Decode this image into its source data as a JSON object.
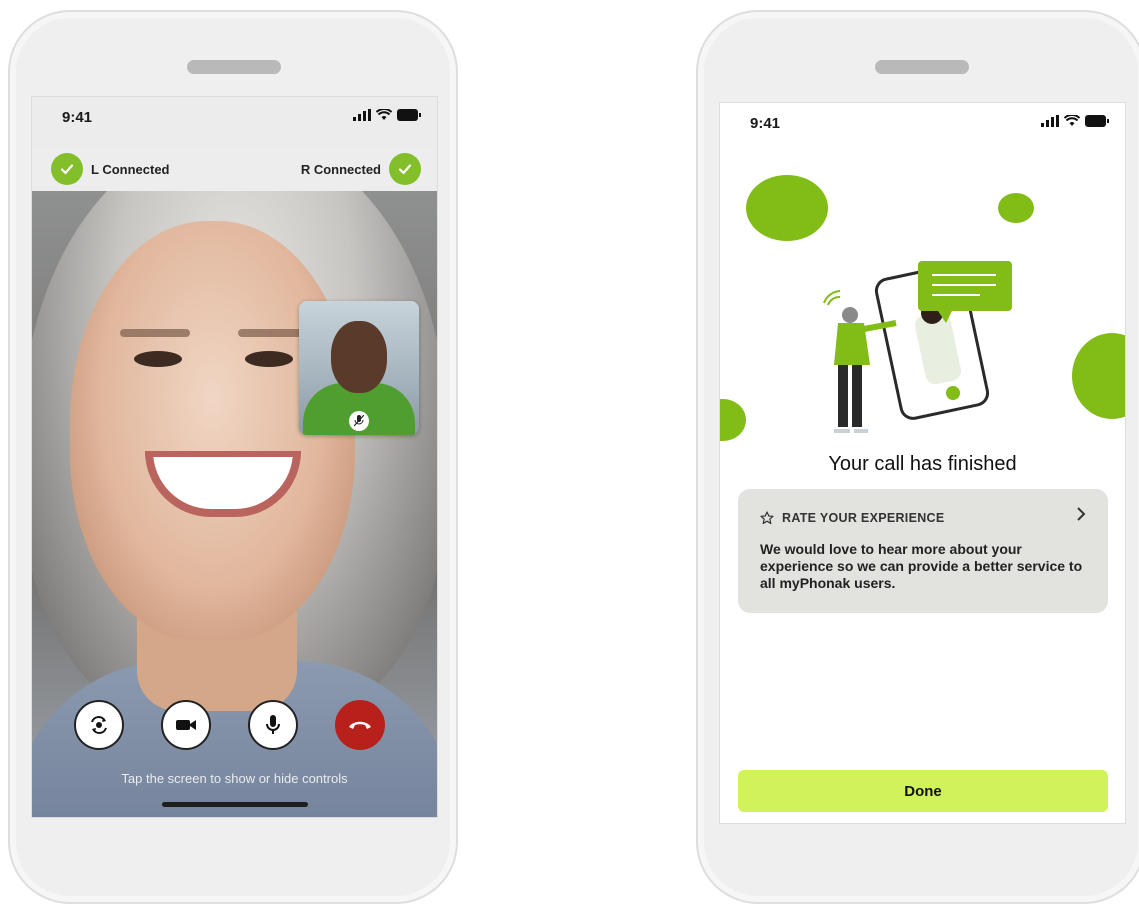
{
  "left_phone": {
    "status_time": "9:41",
    "left_device": {
      "label": "L Connected"
    },
    "right_device": {
      "label": "R Connected"
    },
    "controls": [
      {
        "name": "flip-camera",
        "icon": "camera-rotate-icon"
      },
      {
        "name": "video",
        "icon": "video-camera-icon"
      },
      {
        "name": "microphone",
        "icon": "microphone-icon"
      },
      {
        "name": "end-call",
        "icon": "phone-hangup-icon"
      }
    ],
    "hint": "Tap the screen to show or hide controls"
  },
  "right_phone": {
    "status_time": "9:41",
    "title": "Your call has finished",
    "rate_card": {
      "heading": "RATE YOUR EXPERIENCE",
      "body": "We would love to hear more about your experience so we can provide a better service to all myPhonak users."
    },
    "done_label": "Done"
  },
  "colors": {
    "accent_green": "#82bc16",
    "button_lime": "#d0f25a",
    "end_call_red": "#b8211b"
  }
}
